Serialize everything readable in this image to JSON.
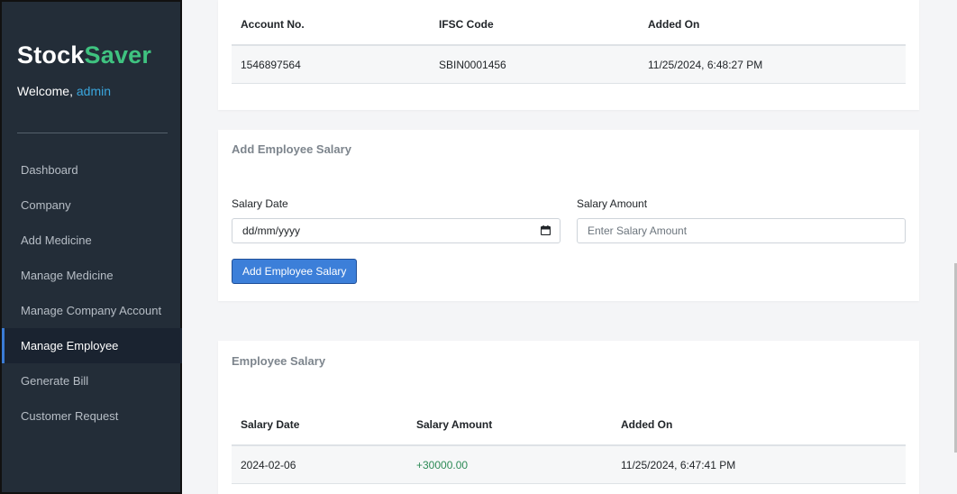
{
  "app": {
    "brand_part1": "Stock",
    "brand_part2": "Saver",
    "welcome_prefix": "Welcome,",
    "username": "admin"
  },
  "sidebar": {
    "items": [
      {
        "label": "Dashboard"
      },
      {
        "label": "Company"
      },
      {
        "label": "Add Medicine"
      },
      {
        "label": "Manage Medicine"
      },
      {
        "label": "Manage Company Account"
      },
      {
        "label": "Manage Employee",
        "active": true
      },
      {
        "label": "Generate Bill"
      },
      {
        "label": "Customer Request"
      }
    ]
  },
  "bank_table": {
    "headers": [
      "Account No.",
      "IFSC Code",
      "Added On"
    ],
    "rows": [
      [
        "1546897564",
        "SBIN0001456",
        "11/25/2024, 6:48:27 PM"
      ]
    ]
  },
  "salary_form": {
    "title": "Add Employee Salary",
    "date_label": "Salary Date",
    "date_value": "dd/mm/yyyy",
    "amount_label": "Salary Amount",
    "amount_placeholder": "Enter Salary Amount",
    "submit_label": "Add Employee Salary"
  },
  "salary_table": {
    "title": "Employee Salary",
    "headers": [
      "Salary Date",
      "Salary Amount",
      "Added On"
    ],
    "rows": [
      [
        "2024-02-06",
        "+30000.00",
        "11/25/2024, 6:47:41 PM"
      ]
    ]
  },
  "colors": {
    "sidebar_bg": "#232d38",
    "brand_accent": "#3fc380",
    "primary_button": "#3c7fd9",
    "amount_positive": "#2e8b57"
  },
  "icons": {
    "date_picker": "calendar-icon"
  }
}
